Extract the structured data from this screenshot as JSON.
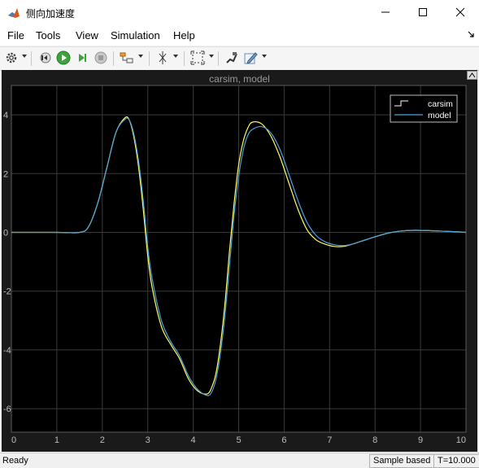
{
  "window": {
    "title": "侧向加速度"
  },
  "menu": [
    "File",
    "Tools",
    "View",
    "Simulation",
    "Help"
  ],
  "toolbar": {
    "settings_icon": "gear-icon",
    "step_back_icon": "step-back-icon",
    "run_icon": "play-icon",
    "step_forward_icon": "step-forward-icon",
    "stop_icon": "stop-icon",
    "highlight_icon": "highlight-block-icon",
    "cursor_icon": "cursor-measure-icon",
    "zoom_fit_icon": "zoom-fit-icon",
    "style_icon": "style-icon",
    "edit_icon": "edit-icon"
  },
  "status": {
    "left": "Ready",
    "sample": "Sample based",
    "time": "T=10.000"
  },
  "colors": {
    "carsim": "#ffff66",
    "model": "#4aa3df",
    "axes_bg": "#000000",
    "grid": "#3a3a3a",
    "tick_text": "#bdbdbd"
  },
  "chart_data": {
    "type": "line",
    "title": "carsim, model",
    "xlabel": "",
    "ylabel": "",
    "xlim": [
      0,
      10
    ],
    "ylim": [
      -6.8,
      5
    ],
    "xticks": [
      0,
      1,
      2,
      3,
      4,
      5,
      6,
      7,
      8,
      9,
      10
    ],
    "yticks": [
      -6,
      -4,
      -2,
      0,
      2,
      4
    ],
    "grid": true,
    "legend_position": "top-right",
    "series": [
      {
        "name": "carsim",
        "x": [
          0,
          1,
          1.5,
          1.7,
          1.9,
          2.1,
          2.3,
          2.5,
          2.6,
          2.7,
          2.8,
          2.9,
          3.0,
          3.1,
          3.3,
          3.5,
          3.7,
          3.9,
          4.1,
          4.3,
          4.4,
          4.5,
          4.6,
          4.7,
          4.8,
          4.9,
          5.0,
          5.1,
          5.2,
          5.3,
          5.5,
          5.7,
          5.9,
          6.1,
          6.3,
          6.5,
          6.7,
          6.9,
          7.1,
          7.3,
          7.5,
          7.7,
          8.0,
          8.3,
          8.6,
          8.9,
          9.2,
          9.5,
          9.8,
          10
        ],
        "y": [
          0,
          0,
          0,
          0.2,
          1.0,
          2.2,
          3.4,
          3.9,
          3.8,
          3.2,
          2.2,
          0.8,
          -0.8,
          -1.9,
          -3.2,
          -3.8,
          -4.3,
          -5.0,
          -5.4,
          -5.5,
          -5.3,
          -4.8,
          -3.8,
          -2.4,
          -0.6,
          1.0,
          2.3,
          3.1,
          3.55,
          3.75,
          3.7,
          3.3,
          2.6,
          1.7,
          0.8,
          0.1,
          -0.25,
          -0.4,
          -0.48,
          -0.48,
          -0.4,
          -0.3,
          -0.15,
          -0.02,
          0.05,
          0.07,
          0.06,
          0.04,
          0.02,
          0
        ]
      },
      {
        "name": "model",
        "x": [
          0,
          1,
          1.5,
          1.7,
          1.9,
          2.1,
          2.3,
          2.5,
          2.6,
          2.7,
          2.8,
          2.9,
          3.0,
          3.1,
          3.3,
          3.5,
          3.7,
          3.9,
          4.1,
          4.3,
          4.4,
          4.5,
          4.6,
          4.7,
          4.8,
          4.9,
          5.0,
          5.1,
          5.2,
          5.3,
          5.5,
          5.7,
          5.9,
          6.1,
          6.3,
          6.5,
          6.7,
          6.9,
          7.1,
          7.3,
          7.5,
          7.7,
          8.0,
          8.3,
          8.6,
          8.9,
          9.2,
          9.5,
          9.8,
          10
        ],
        "y": [
          0,
          0,
          0,
          0.2,
          1.0,
          2.2,
          3.4,
          3.85,
          3.8,
          3.3,
          2.4,
          1.1,
          -0.5,
          -1.6,
          -3.0,
          -3.7,
          -4.2,
          -4.9,
          -5.35,
          -5.55,
          -5.45,
          -5.0,
          -4.1,
          -2.8,
          -1.1,
          0.6,
          1.9,
          2.8,
          3.3,
          3.5,
          3.6,
          3.4,
          2.85,
          2.0,
          1.1,
          0.35,
          -0.1,
          -0.32,
          -0.42,
          -0.45,
          -0.4,
          -0.3,
          -0.15,
          -0.02,
          0.05,
          0.07,
          0.06,
          0.04,
          0.02,
          0
        ]
      }
    ]
  }
}
